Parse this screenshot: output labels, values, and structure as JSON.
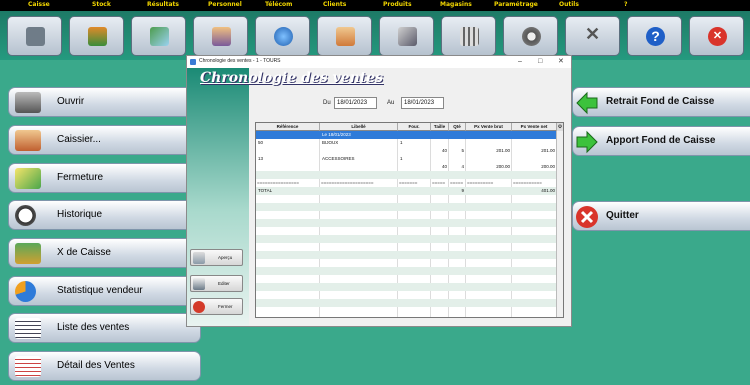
{
  "menu": [
    "Caisse",
    "Stock",
    "Résultats",
    "Personnel",
    "Télécom",
    "Clients",
    "Produits",
    "Magasins",
    "Paramétrage",
    "Outils",
    "?"
  ],
  "toolbar_icons": [
    "cash-register-icon",
    "stock-boxes-icon",
    "results-chart-icon",
    "personnel-icon",
    "telecom-globe-icon",
    "clients-icon",
    "products-icon",
    "stores-building-icon",
    "settings-gear-icon",
    "tools-icon",
    "help-icon",
    "exit-icon"
  ],
  "left_buttons": [
    {
      "label": "Ouvrir",
      "icon": "cash-register-icon"
    },
    {
      "label": "Caissier...",
      "icon": "cashier-users-icon"
    },
    {
      "label": "Fermeture",
      "icon": "closing-cash-icon"
    },
    {
      "label": "Historique",
      "icon": "clock-icon"
    },
    {
      "label": "X de Caisse",
      "icon": "coins-icon"
    },
    {
      "label": "Statistique vendeur",
      "icon": "pie-chart-icon"
    },
    {
      "label": "Liste des ventes",
      "icon": "list-icon"
    },
    {
      "label": "Détail des Ventes",
      "icon": "detail-list-icon"
    }
  ],
  "right_buttons": [
    {
      "label": "Retrait Fond de Caisse",
      "icon": "arrow-left-icon"
    },
    {
      "label": "Apport Fond de Caisse",
      "icon": "arrow-right-icon"
    },
    {
      "label": "Quitter",
      "icon": "close-icon"
    }
  ],
  "dialog": {
    "title": "Chronologie des ventes - 1 - TOURS",
    "heading": "Chronologie des ventes",
    "from_label": "Du",
    "from_value": "18/01/2023",
    "to_label": "Au",
    "to_value": "18/01/2023",
    "columns": [
      "Référence",
      "Libellé",
      "Four.",
      "Taille",
      "Qté",
      "Px Vente brut",
      "Px Vente net"
    ],
    "rows": [
      [
        "",
        "Le 18/01/2023",
        "",
        "",
        "",
        "",
        ""
      ],
      [
        "50",
        "BIJOUX",
        "1",
        "",
        "",
        "",
        ""
      ],
      [
        "",
        "",
        "",
        "40",
        "5",
        "201.00",
        "201.00"
      ],
      [
        "13",
        "ACCESSOIRES",
        "1",
        "",
        "",
        "",
        ""
      ],
      [
        "",
        "",
        "",
        "40",
        "4",
        "200.00",
        "200.00"
      ],
      [
        "================",
        "====================",
        "=======",
        "=====",
        "=====",
        "==========",
        "==========="
      ],
      [
        "TOTAL",
        "",
        "",
        "",
        "9",
        "",
        "401.00"
      ]
    ],
    "side_buttons": [
      "Aperçu",
      "Editer",
      "Fermer"
    ]
  },
  "colors": {
    "background": "#3aa98b",
    "menu_text": "#f2d600",
    "selection": "#2f7bd9"
  }
}
